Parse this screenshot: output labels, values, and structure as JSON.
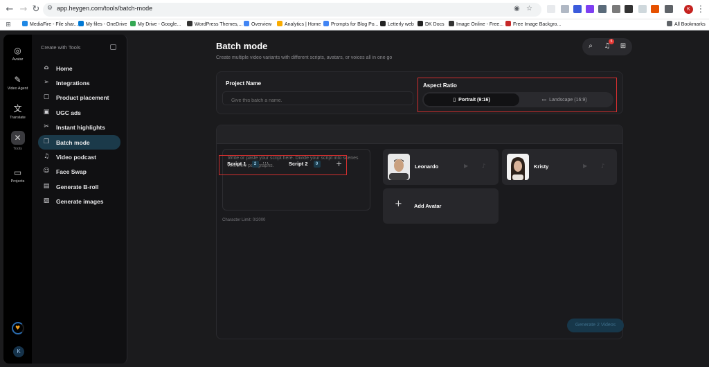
{
  "browser": {
    "url": "app.heygen.com/tools/batch-mode",
    "bookmarks": [
      {
        "label": "MediaFire - File shar...",
        "color": "#1e88e5"
      },
      {
        "label": "My files - OneDrive",
        "color": "#0078d4"
      },
      {
        "label": "My Drive - Google...",
        "color": "#34a853"
      },
      {
        "label": "WordPress Themes,...",
        "color": "#333333"
      },
      {
        "label": "Overview",
        "color": "#4285f4"
      },
      {
        "label": "Analytics | Home",
        "color": "#f9ab00"
      },
      {
        "label": "Prompts for Blog Po...",
        "color": "#4285f4"
      },
      {
        "label": "Letterly web",
        "color": "#222222"
      },
      {
        "label": "DK Docs",
        "color": "#222222"
      },
      {
        "label": "Image Online - Free...",
        "color": "#333333"
      },
      {
        "label": "Free Image Backgro...",
        "color": "#c62828"
      }
    ],
    "all_bookmarks": "All Bookmarks",
    "profile_initial": "K"
  },
  "rail": {
    "items": [
      {
        "label": "Avatar",
        "icon": "avatar-icon"
      },
      {
        "label": "Video Agent",
        "icon": "video-agent-icon"
      },
      {
        "label": "Translate",
        "icon": "translate-icon"
      },
      {
        "label": "Tools",
        "icon": "tools-icon"
      },
      {
        "label": "Projects",
        "icon": "folder-icon"
      }
    ],
    "user_initial": "K"
  },
  "sidebar": {
    "heading": "Create with Tools",
    "items": [
      {
        "label": "Home",
        "icon": "home-icon"
      },
      {
        "label": "Integrations",
        "icon": "send-icon"
      },
      {
        "label": "Product placement",
        "icon": "bag-icon"
      },
      {
        "label": "UGC ads",
        "icon": "ugc-icon"
      },
      {
        "label": "Instant highlights",
        "icon": "scissors-icon"
      },
      {
        "label": "Batch mode",
        "icon": "batch-icon"
      },
      {
        "label": "Video podcast",
        "icon": "podcast-icon"
      },
      {
        "label": "Face Swap",
        "icon": "face-swap-icon"
      },
      {
        "label": "Generate B-roll",
        "icon": "broll-icon"
      },
      {
        "label": "Generate images",
        "icon": "image-icon"
      }
    ],
    "active_index": 5
  },
  "main": {
    "title": "Batch mode",
    "subtitle": "Create multiple video variants with different scripts, avatars, or voices all in one go",
    "notifications_count": "5",
    "project_name_label": "Project Name",
    "project_name_placeholder": "Give this batch a name.",
    "aspect_ratio": {
      "label": "Aspect Ratio",
      "portrait": "Portrait (9:16)",
      "landscape": "Landscape (16:9)",
      "selected": "portrait"
    },
    "tabs": [
      {
        "label": "Script 1",
        "count": "2"
      },
      {
        "label": "Script 2",
        "count": "0"
      }
    ],
    "script_placeholder": "Write or paste your script here. Divide your script into scenes with new paragraphs.",
    "char_limit": "Character Limit: 0/2000",
    "avatars": [
      {
        "name": "Leonardo"
      },
      {
        "name": "Kristy"
      }
    ],
    "add_avatar": "Add Avatar",
    "generate_button": "Generate 2 Videos"
  }
}
